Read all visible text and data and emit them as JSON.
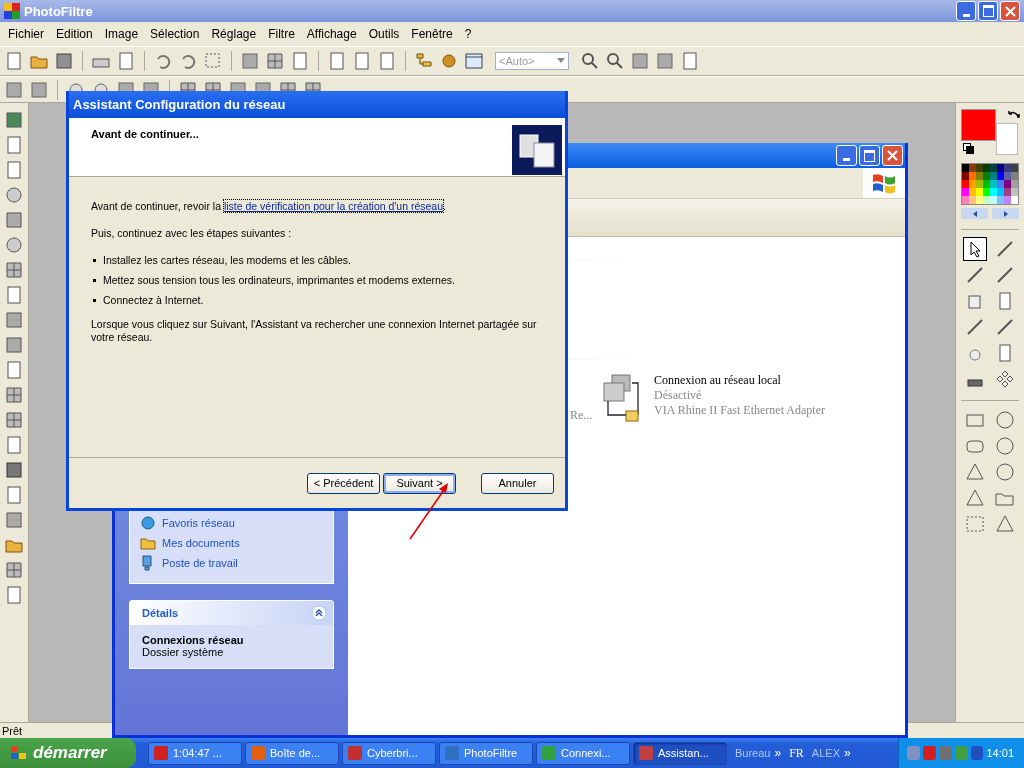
{
  "app": {
    "title": "PhotoFiltre",
    "menu": [
      "Fichier",
      "Edition",
      "Image",
      "Sélection",
      "Réglage",
      "Filtre",
      "Affichage",
      "Outils",
      "Fenêtre",
      "?"
    ],
    "zoom_field": {
      "placeholder": "<Auto>"
    },
    "status": "Prêt"
  },
  "colors": {
    "current": [
      {
        "color": "#ff0000"
      },
      {
        "color": "#ffffff"
      }
    ],
    "swatches": [
      {
        "color": "#000000"
      },
      {
        "color": "#8b3a0a"
      },
      {
        "color": "#404000"
      },
      {
        "color": "#004000"
      },
      {
        "color": "#004040"
      },
      {
        "color": "#000080"
      },
      {
        "color": "#3a3a80"
      },
      {
        "color": "#404040"
      },
      {
        "color": "#800000"
      },
      {
        "color": "#ff7000"
      },
      {
        "color": "#808000"
      },
      {
        "color": "#008000"
      },
      {
        "color": "#008080"
      },
      {
        "color": "#0000ff"
      },
      {
        "color": "#6060a0"
      },
      {
        "color": "#808080"
      },
      {
        "color": "#ff0000"
      },
      {
        "color": "#ffa000"
      },
      {
        "color": "#a0c000"
      },
      {
        "color": "#00c000"
      },
      {
        "color": "#00c0c0"
      },
      {
        "color": "#4080ff"
      },
      {
        "color": "#800080"
      },
      {
        "color": "#a0a0a0"
      },
      {
        "color": "#ff00ff"
      },
      {
        "color": "#ffc000"
      },
      {
        "color": "#ffff00"
      },
      {
        "color": "#00ff00"
      },
      {
        "color": "#00ffff"
      },
      {
        "color": "#00c0ff"
      },
      {
        "color": "#a04080"
      },
      {
        "color": "#c0c0c0"
      },
      {
        "color": "#ff80c0"
      },
      {
        "color": "#ffc080"
      },
      {
        "color": "#ffff80"
      },
      {
        "color": "#c0ffc0"
      },
      {
        "color": "#c0ffff"
      },
      {
        "color": "#80c0ff"
      },
      {
        "color": "#c080ff"
      },
      {
        "color": "#ffffff"
      }
    ]
  },
  "network_window": {
    "task_links": [
      {
        "label": "Favoris réseau"
      },
      {
        "label": "Mes documents"
      },
      {
        "label": "Poste de travail"
      }
    ],
    "details": {
      "title": "Détails",
      "name": "Connexions réseau",
      "type": "Dossier système"
    },
    "cut_item": "Re...",
    "connection": {
      "name": "Connexion au réseau local",
      "status": "Désactivé",
      "adapter": "VIA Rhine II Fast Ethernet Adapter"
    }
  },
  "dialog": {
    "title": "Assistant Configuration du réseau",
    "heading": "Avant de continuer...",
    "intro": "Avant de continuer, revoir la",
    "link": "liste de vérification pour la création d'un réseau",
    "intro_end": ".",
    "steps_intro": "Puis, continuez avec les étapes suivantes :",
    "steps": [
      "Installez les cartes réseau, les modems et les câbles.",
      "Mettez sous tension tous les ordinateurs, imprimantes et modems externes.",
      "Connectez à Internet."
    ],
    "closing": "Lorsque vous cliquez sur Suivant, l'Assistant va rechercher une connexion Internet partagée sur votre réseau.",
    "buttons": [
      {
        "label": "< Précédent",
        "default": false
      },
      {
        "label": "Suivant >",
        "default": true
      },
      {
        "label": "Annuler",
        "default": false
      }
    ]
  },
  "taskbar": {
    "start": "démarrer",
    "tasks": [
      {
        "label": "1:04:47 ...",
        "selected": false
      },
      {
        "label": "Boîte de...",
        "selected": false
      },
      {
        "label": "Cyberbri...",
        "selected": false
      },
      {
        "label": "PhotoFiltre",
        "selected": false
      },
      {
        "label": "Connexi...",
        "selected": false
      },
      {
        "label": "Assistan...",
        "selected": true
      }
    ],
    "toolbar_label": "Bureau",
    "chevron": "»",
    "language": "FR",
    "user": "ALEX",
    "chevron_2": "»",
    "clock": "14:01"
  }
}
